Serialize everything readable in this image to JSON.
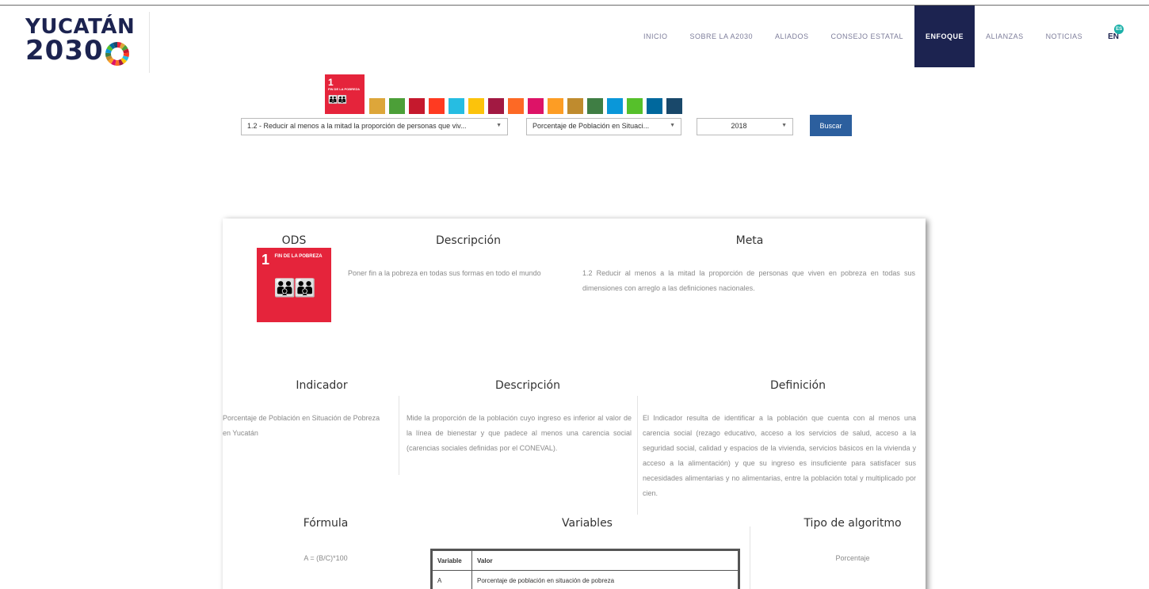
{
  "brand": {
    "line1": "YUCATÁN",
    "line2": "2030"
  },
  "nav": {
    "items": [
      "INICIO",
      "SOBRE LA A2030",
      "ALIADOS",
      "CONSEJO ESTATAL",
      "ENFOQUE",
      "ALIANZAS",
      "NOTICIAS"
    ],
    "active": "ENFOQUE",
    "lang": "EN",
    "lang_badge": "ES"
  },
  "sdg_strip": {
    "selected": {
      "number": "1",
      "title": "FIN DE LA POBREZA"
    },
    "colors": [
      "#e5243b",
      "#dda63a",
      "#4c9f38",
      "#c5192d",
      "#ff3a21",
      "#26bde2",
      "#fcc30b",
      "#a21942",
      "#fd6925",
      "#dd1367",
      "#fd9d24",
      "#bf8b2e",
      "#3f7e44",
      "#0a97d9",
      "#56c02b",
      "#00689d",
      "#19486a"
    ]
  },
  "filters": {
    "meta": "1.2 - Reducir al menos a la mitad la proporción de personas que viv...",
    "indicador": "Porcentaje de Población en Situaci...",
    "year": "2018",
    "search_button": "Buscar"
  },
  "card": {
    "ods_heading": "ODS",
    "ods_tile": {
      "number": "1",
      "title": "FIN DE LA POBREZA"
    },
    "descripcion_heading": "Descripción",
    "descripcion_text": "Poner fin a la pobreza en todas sus formas en todo el mundo",
    "meta_heading": "Meta",
    "meta_text": "1.2 Reducir al menos a la mitad la proporción de personas que viven en pobreza en todas sus dimensiones con arreglo a las definiciones nacionales.",
    "indicador_heading": "Indicador",
    "indicador_text": "Porcentaje de Población en Situación de Pobreza en Yucatán",
    "descripcion2_heading": "Descripción",
    "descripcion2_text": "Mide la proporción de la población cuyo ingreso es inferior al valor de la línea de bienestar y que padece al menos una carencia social (carencias sociales definidas por el CONEVAL).",
    "definicion_heading": "Definición",
    "definicion_text": "El Indicador resulta de identificar a la población que cuenta con al menos una carencia social (rezago educativo, acceso a los servicios de salud, acceso a la seguridad social, calidad y espacios de la vivienda, servicios básicos en la vivienda y acceso a la alimentación) y que su ingreso es insuficiente para satisfacer sus necesidades alimentarias y no alimentarias, entre la población total y multiplicado por cien.",
    "formula_heading": "Fórmula",
    "formula_text": "A = (B/C)*100",
    "variables_heading": "Variables",
    "variables_table": {
      "headers": [
        "Variable",
        "Valor"
      ],
      "rows": [
        [
          "A",
          "Porcentaje de población en situación de pobreza"
        ]
      ]
    },
    "algoritmo_heading": "Tipo de algoritmo",
    "algoritmo_text": "Porcentaje"
  }
}
